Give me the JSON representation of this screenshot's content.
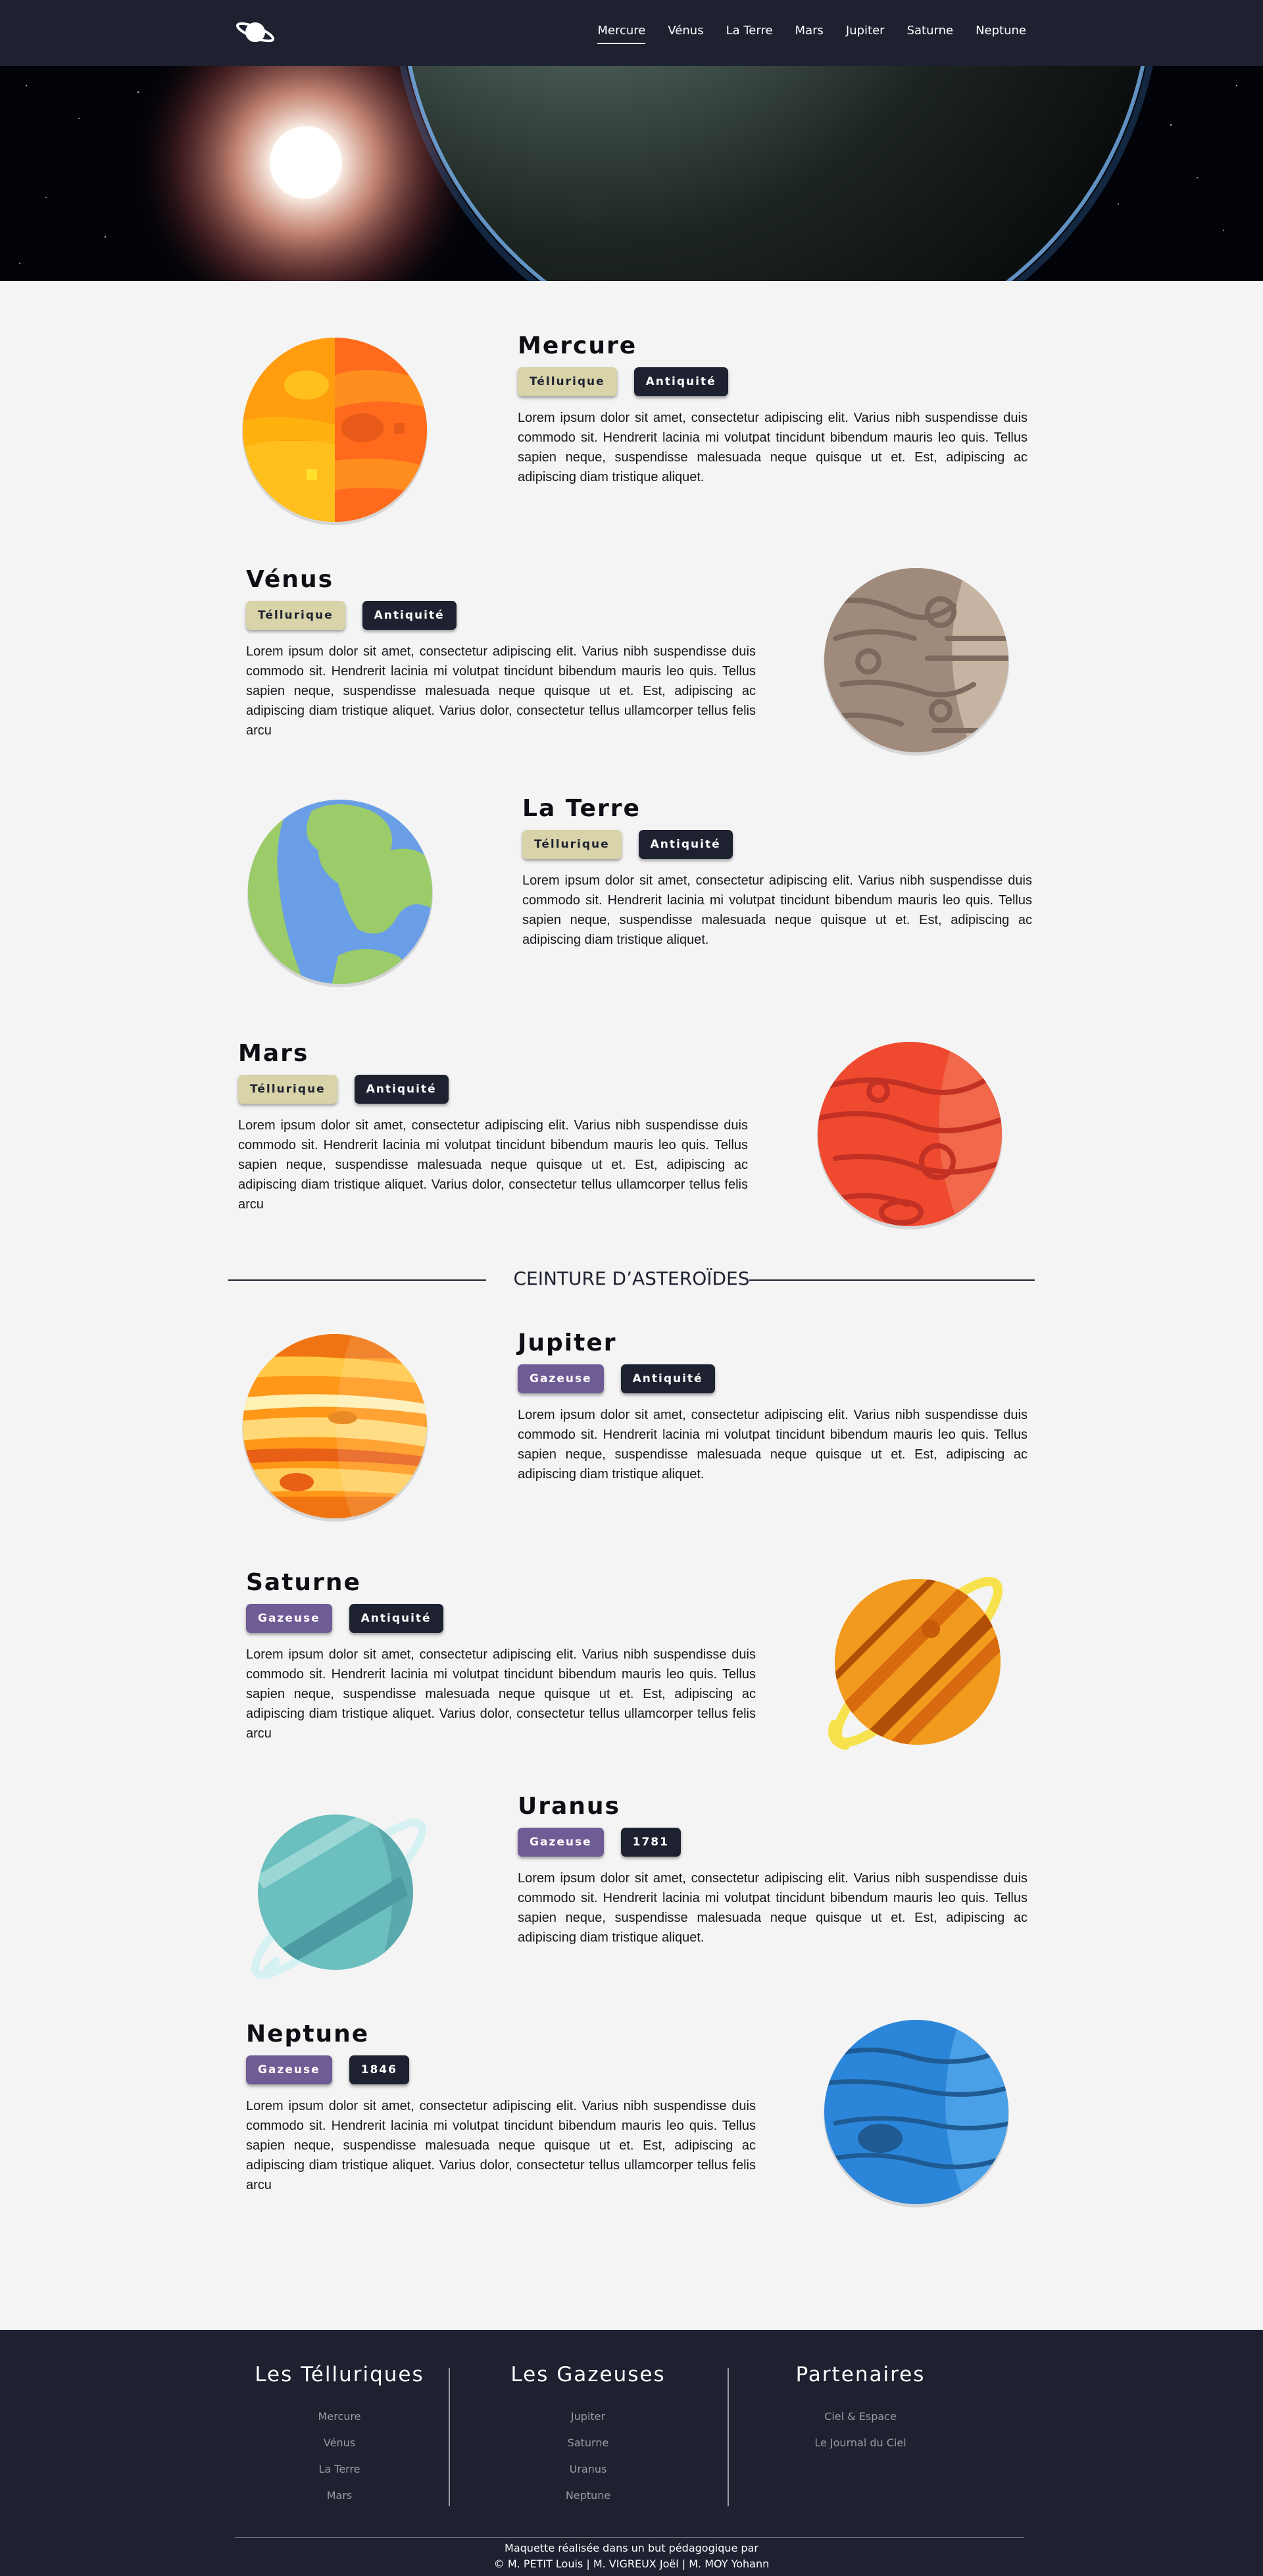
{
  "nav": {
    "logo_icon": "saturn-logo-icon",
    "items": [
      {
        "label": "Mercure",
        "active": true
      },
      {
        "label": "Vénus",
        "active": false
      },
      {
        "label": "La Terre",
        "active": false
      },
      {
        "label": "Mars",
        "active": false
      },
      {
        "label": "Jupiter",
        "active": false
      },
      {
        "label": "Saturne",
        "active": false
      },
      {
        "label": "Neptune",
        "active": false
      }
    ]
  },
  "hero": {
    "image": "space-earth-sun-banner"
  },
  "planets": [
    {
      "name": "Mercure",
      "type": "Téllurique",
      "tag2": "Antiquité",
      "icon": "mercury-icon",
      "text": "Lorem ipsum dolor sit amet, consectetur adipiscing elit. Varius nibh suspendisse duis commodo sit. Hendrerit lacinia mi volutpat tincidunt bibendum mauris leo quis. Tellus sapien neque, suspendisse malesuada neque quisque ut et. Est, adipiscing ac adipiscing diam tristique aliquet."
    },
    {
      "name": "Vénus",
      "type": "Téllurique",
      "tag2": "Antiquité",
      "icon": "venus-icon",
      "text": "Lorem ipsum dolor sit amet, consectetur adipiscing elit. Varius nibh suspendisse duis commodo sit. Hendrerit lacinia mi volutpat tincidunt bibendum mauris leo quis. Tellus sapien neque, suspendisse malesuada neque quisque ut et. Est, adipiscing ac adipiscing diam tristique aliquet. Varius dolor, consectetur tellus ullamcorper tellus felis arcu"
    },
    {
      "name": "La Terre",
      "type": "Téllurique",
      "tag2": "Antiquité",
      "icon": "earth-icon",
      "text": "Lorem ipsum dolor sit amet, consectetur adipiscing elit. Varius nibh suspendisse duis commodo sit. Hendrerit lacinia mi volutpat tincidunt bibendum mauris leo quis. Tellus sapien neque, suspendisse malesuada neque quisque ut et. Est, adipiscing ac adipiscing diam tristique aliquet."
    },
    {
      "name": "Mars",
      "type": "Téllurique",
      "tag2": "Antiquité",
      "icon": "mars-icon",
      "text": "Lorem ipsum dolor sit amet, consectetur adipiscing elit. Varius nibh suspendisse duis commodo sit. Hendrerit lacinia mi volutpat tincidunt bibendum mauris leo quis. Tellus sapien neque, suspendisse malesuada neque quisque ut et. Est, adipiscing ac adipiscing diam tristique aliquet. Varius dolor, consectetur tellus ullamcorper tellus felis arcu"
    },
    {
      "name": "Jupiter",
      "type": "Gazeuse",
      "tag2": "Antiquité",
      "icon": "jupiter-icon",
      "text": "Lorem ipsum dolor sit amet, consectetur adipiscing elit. Varius nibh suspendisse duis commodo sit. Hendrerit lacinia mi volutpat tincidunt bibendum mauris leo quis. Tellus sapien neque, suspendisse malesuada neque quisque ut et. Est, adipiscing ac adipiscing diam tristique aliquet."
    },
    {
      "name": "Saturne",
      "type": "Gazeuse",
      "tag2": "Antiquité",
      "icon": "saturn-icon",
      "text": "Lorem ipsum dolor sit amet, consectetur adipiscing elit. Varius nibh suspendisse duis commodo sit. Hendrerit lacinia mi volutpat tincidunt bibendum mauris leo quis. Tellus sapien neque, suspendisse malesuada neque quisque ut et. Est, adipiscing ac adipiscing diam tristique aliquet. Varius dolor, consectetur tellus ullamcorper tellus felis arcu"
    },
    {
      "name": "Uranus",
      "type": "Gazeuse",
      "tag2": "1781",
      "icon": "uranus-icon",
      "text": "Lorem ipsum dolor sit amet, consectetur adipiscing elit. Varius nibh suspendisse duis commodo sit. Hendrerit lacinia mi volutpat tincidunt bibendum mauris leo quis. Tellus sapien neque, suspendisse malesuada neque quisque ut et. Est, adipiscing ac adipiscing diam tristique aliquet."
    },
    {
      "name": "Neptune",
      "type": "Gazeuse",
      "tag2": "1846",
      "icon": "neptune-icon",
      "text": "Lorem ipsum dolor sit amet, consectetur adipiscing elit. Varius nibh suspendisse duis commodo sit. Hendrerit lacinia mi volutpat tincidunt bibendum mauris leo quis. Tellus sapien neque, suspendisse malesuada neque quisque ut et. Est, adipiscing ac adipiscing diam tristique aliquet. Varius dolor, consectetur tellus ullamcorper tellus felis arcu"
    }
  ],
  "belt": {
    "label": "CEINTURE D’ASTEROÏDES"
  },
  "footer": {
    "columns": [
      {
        "title": "Les Télluriques",
        "links": [
          "Mercure",
          "Vénus",
          "La Terre",
          "Mars"
        ]
      },
      {
        "title": "Les Gazeuses",
        "links": [
          "Jupiter",
          "Saturne",
          "Uranus",
          "Neptune"
        ]
      },
      {
        "title": "Partenaires",
        "links": [
          "Ciel & Espace",
          "Le Journal du Ciel"
        ]
      }
    ],
    "credit_line1": "Maquette réalisée dans un but pédagogique par",
    "credit_line2": "© M. PETIT Louis | M. VIGREUX Joël | M. MOY Yohann"
  },
  "colors": {
    "nav_bg": "#1d2130",
    "page_bg": "#f4f4f4",
    "tag_tellurique": "#d8d3a8",
    "tag_gazeuse": "#705c94",
    "tag_dark": "#1d2130"
  }
}
